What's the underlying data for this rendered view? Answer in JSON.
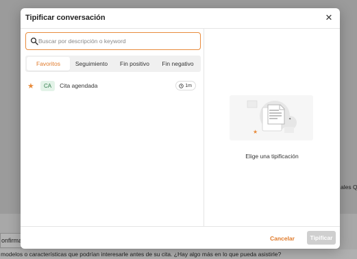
{
  "background": {
    "confirm_text": "onfirma",
    "message_line": "modelos o características que podrían interesarle antes de su cita. ¿Hay algo más en lo que pueda asistirle?",
    "side_text": "ales Qu"
  },
  "modal": {
    "title": "Tipificar conversación",
    "close_icon": "close-icon",
    "search": {
      "placeholder": "Buscar por descripción o keyword",
      "value": ""
    },
    "tabs": [
      {
        "label": "Favoritos",
        "active": true
      },
      {
        "label": "Seguimiento",
        "active": false
      },
      {
        "label": "Fin positivo",
        "active": false
      },
      {
        "label": "Fin negativo",
        "active": false
      }
    ],
    "items": [
      {
        "star": "★",
        "code": "CA",
        "label": "Cita agendada",
        "time": "1m"
      }
    ],
    "empty_state": {
      "text": "Elige una tipificación"
    },
    "footer": {
      "cancel_label": "Cancelar",
      "submit_label": "Tipificar"
    },
    "colors": {
      "accent": "#e07a2a",
      "badge_bg": "#e3f3e8",
      "badge_text": "#2f7a4a",
      "disabled": "#cfcfcf"
    }
  }
}
